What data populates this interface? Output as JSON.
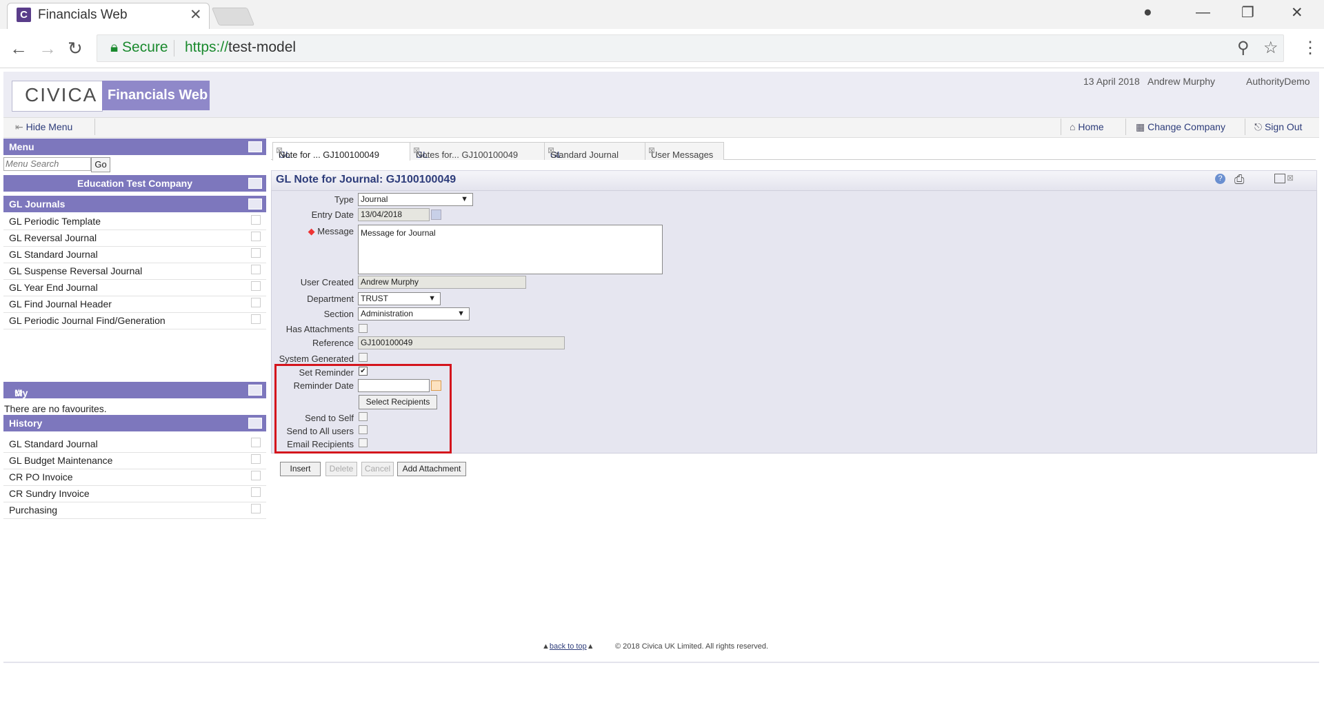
{
  "browser": {
    "tab_title": "Financials Web",
    "secure_label": "Secure",
    "url_scheme": "https://",
    "url_host": "test-model"
  },
  "header": {
    "logo": "CIVICA",
    "app_name": "Financials Web",
    "date": "13 April 2018",
    "user": "Andrew Murphy",
    "authority": "AuthorityDemo"
  },
  "topnav": {
    "hide_menu": "Hide Menu",
    "home": "Home",
    "change_company": "Change Company",
    "sign_out": "Sign Out"
  },
  "menu": {
    "title": "Menu",
    "search_placeholder": "Menu Search",
    "go": "Go",
    "company": "Education Test Company",
    "section": "GL Journals",
    "items": [
      "GL Periodic Template",
      "GL Reversal Journal",
      "GL Standard Journal",
      "GL Suspense Reversal Journal",
      "GL Year End Journal",
      "GL Find Journal Header",
      "GL Periodic Journal Find/Generation"
    ],
    "favourites_title": "My Favourites",
    "no_favourites": "There are no favourites.",
    "history_title": "History",
    "history": [
      "GL Standard Journal",
      "GL Budget Maintenance",
      "CR PO Invoice",
      "CR Sundry Invoice",
      "Purchasing"
    ]
  },
  "tabs": [
    {
      "prefix": "GL",
      "label": " Note for ... GJ100100049"
    },
    {
      "prefix": "GL",
      "label": " Notes for... GJ100100049"
    },
    {
      "prefix": "GL",
      "label": " Standard Journal"
    },
    {
      "prefix": "",
      "label": "User Messages"
    }
  ],
  "form": {
    "title": "GL Note for Journal: GJ100100049",
    "labels": {
      "type": "Type",
      "entry_date": "Entry Date",
      "message": "Message",
      "user_created": "User Created",
      "department": "Department",
      "section": "Section",
      "has_attachments": "Has Attachments",
      "reference": "Reference",
      "system_generated": "System Generated",
      "set_reminder": "Set Reminder",
      "reminder_date": "Reminder Date",
      "send_to_self": "Send to Self",
      "send_to_all": "Send to All users",
      "email_recipients": "Email Recipients"
    },
    "values": {
      "type": "Journal",
      "entry_date": "13/04/2018",
      "message": "Message for Journal",
      "user_created": "Andrew Murphy",
      "department": "TRUST",
      "section": "Administration",
      "reference": "GJ100100049",
      "reminder_date": "",
      "set_reminder": true,
      "send_to_self": false,
      "send_to_all": false,
      "email_recipients": false,
      "has_attachments": false,
      "system_generated": false
    },
    "select_recipients": "Select Recipients",
    "buttons": {
      "insert": "Insert",
      "delete": "Delete",
      "cancel": "Cancel",
      "add_attachment": "Add Attachment"
    }
  },
  "footer": {
    "back_to_top": "back to top",
    "copyright": "© 2018 Civica UK Limited. All rights reserved."
  },
  "colors": {
    "accent": "#7d77bd",
    "link": "#2d3c7a",
    "highlight": "#d4141c"
  }
}
